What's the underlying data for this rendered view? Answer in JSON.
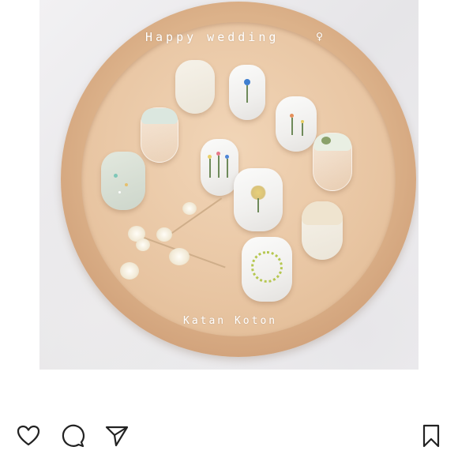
{
  "post": {
    "overlay_title": "Happy  wedding",
    "overlay_title_icon": "♀",
    "overlay_credit": "Katan Koton"
  },
  "actions": {
    "like_icon": "heart-icon",
    "comment_icon": "comment-icon",
    "share_icon": "send-icon",
    "save_icon": "bookmark-icon"
  },
  "colors": {
    "plate": "#dcb28a",
    "background": "#ffffff",
    "icon": "#222222"
  }
}
